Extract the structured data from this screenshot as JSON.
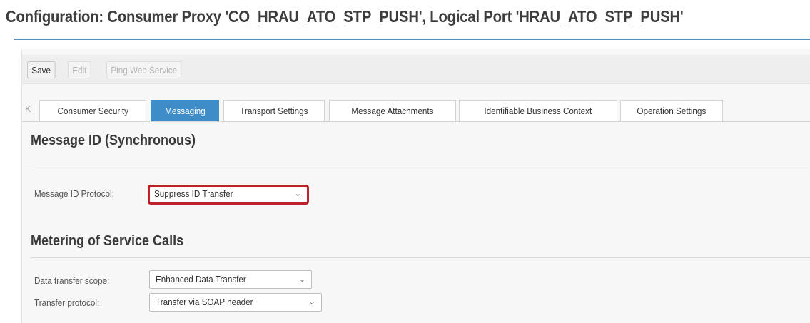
{
  "page_title": "Configuration: Consumer Proxy 'CO_HRAU_ATO_STP_PUSH', Logical Port 'HRAU_ATO_STP_PUSH'",
  "toolbar": {
    "save_label": "Save",
    "edit_label": "Edit",
    "ping_label": "Ping Web Service"
  },
  "tabs": {
    "nav_glyph": "K",
    "items": [
      {
        "label": "Consumer Security"
      },
      {
        "label": "Messaging"
      },
      {
        "label": "Transport Settings"
      },
      {
        "label": "Message Attachments"
      },
      {
        "label": "Identifiable Business Context"
      },
      {
        "label": "Operation Settings"
      }
    ],
    "active": "Messaging"
  },
  "message_id_section": {
    "title": "Message ID (Synchronous)",
    "protocol_label": "Message ID Protocol:",
    "protocol_value": "Suppress ID Transfer"
  },
  "metering_section": {
    "title": "Metering of Service Calls",
    "scope_label": "Data transfer scope:",
    "scope_value": "Enhanced Data Transfer",
    "protocol_label": "Transfer protocol:",
    "protocol_value": "Transfer via SOAP header"
  },
  "icons": {
    "dropdown": "chevron-down-icon",
    "first_tab": "first-tab-icon"
  },
  "colors": {
    "active_tab": "#3f8dc8",
    "highlight_border": "#c0202a",
    "title_rule": "#5b8db8"
  }
}
